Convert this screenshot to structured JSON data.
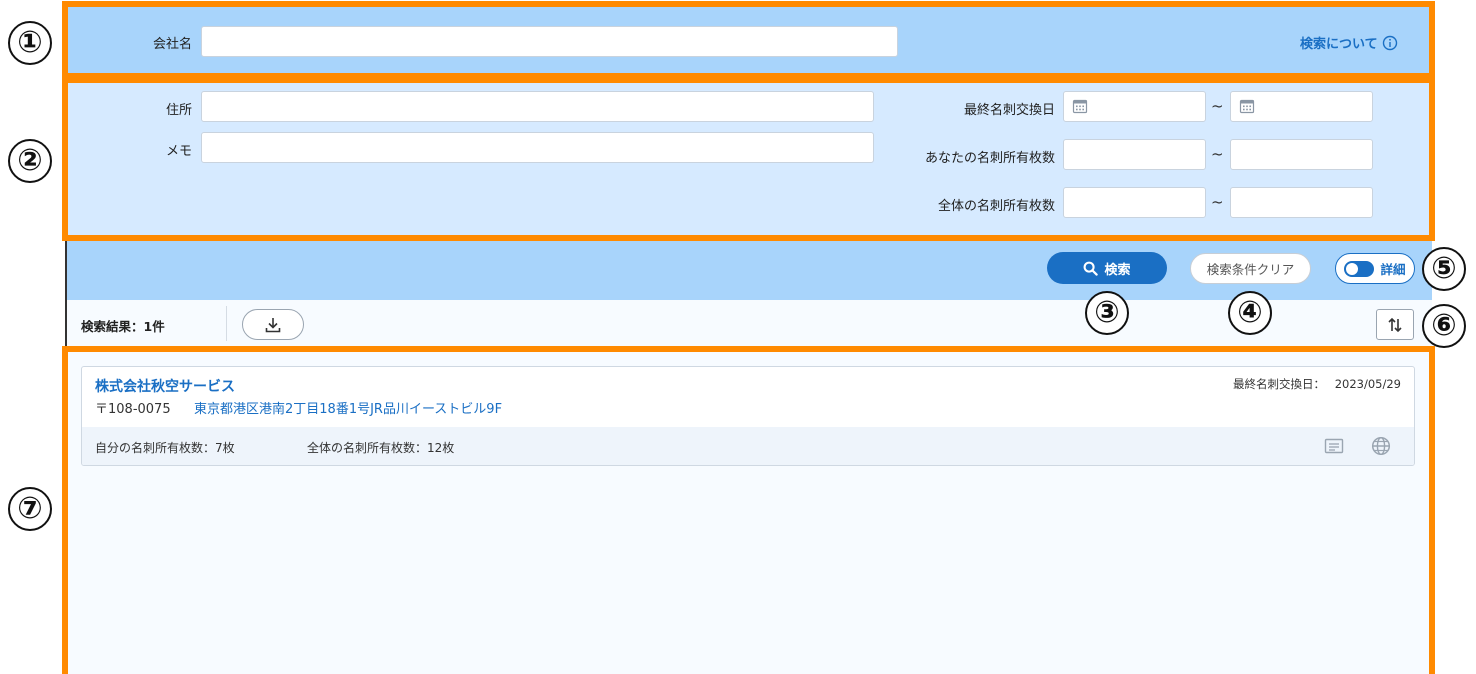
{
  "annotations": [
    "①",
    "②",
    "③",
    "④",
    "⑤",
    "⑥",
    "⑦"
  ],
  "colors": {
    "accent": "#1a6fc4",
    "band": "#a8d4fb",
    "panel": "#d6eaff",
    "highlight": "#ff8a00"
  },
  "search": {
    "company_label": "会社名",
    "company_value": "",
    "about_link": "検索について",
    "address_label": "住所",
    "memo_label": "メモ",
    "last_exchange_label": "最終名刺交換日",
    "your_cards_label": "あなたの名刺所有枚数",
    "all_cards_label": "全体の名刺所有枚数",
    "range_separator": "~"
  },
  "actions": {
    "search_button": "検索",
    "clear_button": "検索条件クリア",
    "detail_toggle": "詳細"
  },
  "results": {
    "count_label": "検索結果：1件",
    "items": [
      {
        "company": "株式会社秋空サービス",
        "postal": "〒108-0075",
        "address": "東京都港区港南2丁目18番1号JR品川イーストビル9F",
        "last_exchange_label": "最終名刺交換日：",
        "last_exchange_date": "2023/05/29",
        "own_cards": "自分の名刺所有枚数：7枚",
        "all_cards": "全体の名刺所有枚数：12枚"
      }
    ]
  }
}
